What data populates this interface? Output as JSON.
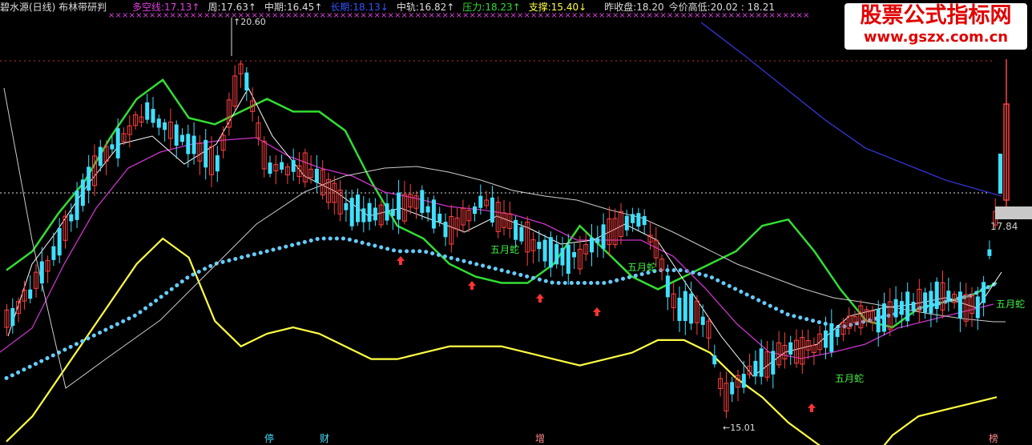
{
  "header": {
    "title": "碧水源(日线) 布林带研判",
    "items": [
      {
        "label": "多空线:",
        "value": "17.13",
        "arrow": "↑",
        "color": "#e040e0"
      },
      {
        "label": "周:",
        "value": "17.63",
        "arrow": "↑",
        "color": "#dddddd"
      },
      {
        "label": "中期:",
        "value": "16.45",
        "arrow": "↑",
        "color": "#dddddd"
      },
      {
        "label": "长期:",
        "value": "18.13",
        "arrow": "↓",
        "color": "#3355ff"
      },
      {
        "label": "中轨:",
        "value": "16.82",
        "arrow": "↑",
        "color": "#dddddd"
      },
      {
        "label": "压力:",
        "value": "18.23",
        "arrow": "↑",
        "color": "#33dd33"
      },
      {
        "label": "支撑:",
        "value": "15.40",
        "arrow": "↓",
        "color": "#ffff44"
      },
      {
        "label": "昨收盘:",
        "value": "18.20",
        "arrow": "",
        "color": "#dddddd"
      },
      {
        "label": "今价高低:",
        "value": "20.02 : 18.21",
        "arrow": "",
        "color": "#dddddd"
      }
    ]
  },
  "watermark": {
    "title": "股票公式指标网",
    "url": "www.gszx.com.cn"
  },
  "axis_labels": {
    "high": "20.60",
    "low": "15.01",
    "right_price": "17.84"
  },
  "bottom_markers": [
    "停",
    "财",
    "增",
    "榜"
  ],
  "snake_label": "五月蛇",
  "colors": {
    "up": "#ff4040",
    "down": "#40e0ff",
    "upper_band": "#33dd33",
    "lower_band": "#ffff44",
    "short_ma": "#ffffff",
    "mid_ma": "#cc33cc",
    "long_ma": "#3333cc",
    "dots": "#66ccff",
    "grid": "#aa2222"
  },
  "chart_data": {
    "type": "candlestick",
    "ylim": [
      15.0,
      20.6
    ],
    "annotations": {
      "high": 20.6,
      "low": 15.01,
      "last": 17.84
    },
    "series": [
      {
        "name": "多空线",
        "values": [
          15.6,
          15.8,
          16.0,
          16.2,
          16.4,
          16.6,
          16.9,
          17.2,
          17.4,
          17.5,
          17.6,
          17.7,
          17.8,
          17.8,
          17.7,
          17.6,
          17.6,
          17.5,
          17.4,
          17.3,
          17.2,
          17.1,
          17.1,
          17.1,
          17.2,
          17.3,
          17.3,
          17.2,
          17.0,
          16.8,
          16.6,
          16.5,
          16.4,
          16.5,
          16.6,
          16.7,
          16.8,
          16.9,
          17.1
        ]
      },
      {
        "name": "压力",
        "values": [
          17.3,
          17.6,
          18.2,
          18.7,
          19.4,
          20.0,
          20.3,
          19.7,
          19.6,
          19.8,
          20.0,
          19.8,
          19.8,
          19.5,
          18.7,
          18.0,
          17.8,
          17.4,
          17.2,
          17.1,
          17.1,
          17.4,
          18.0,
          17.6,
          17.2,
          17.0,
          17.2,
          17.4,
          17.6,
          18.0,
          18.1,
          17.6,
          17.0,
          16.5,
          16.4,
          16.7,
          16.8,
          16.9,
          17.1
        ]
      },
      {
        "name": "支撑",
        "values": [
          14.6,
          15.0,
          15.6,
          16.2,
          16.8,
          17.4,
          17.8,
          17.5,
          16.5,
          16.1,
          16.3,
          16.4,
          16.3,
          16.1,
          15.9,
          15.9,
          16.0,
          16.1,
          16.1,
          16.1,
          16.0,
          15.9,
          15.8,
          15.9,
          16.0,
          16.2,
          16.2,
          16.0,
          15.6,
          15.3,
          14.9,
          14.6,
          14.3,
          14.2,
          14.7,
          15.0,
          15.1,
          15.2,
          15.3
        ]
      }
    ]
  }
}
